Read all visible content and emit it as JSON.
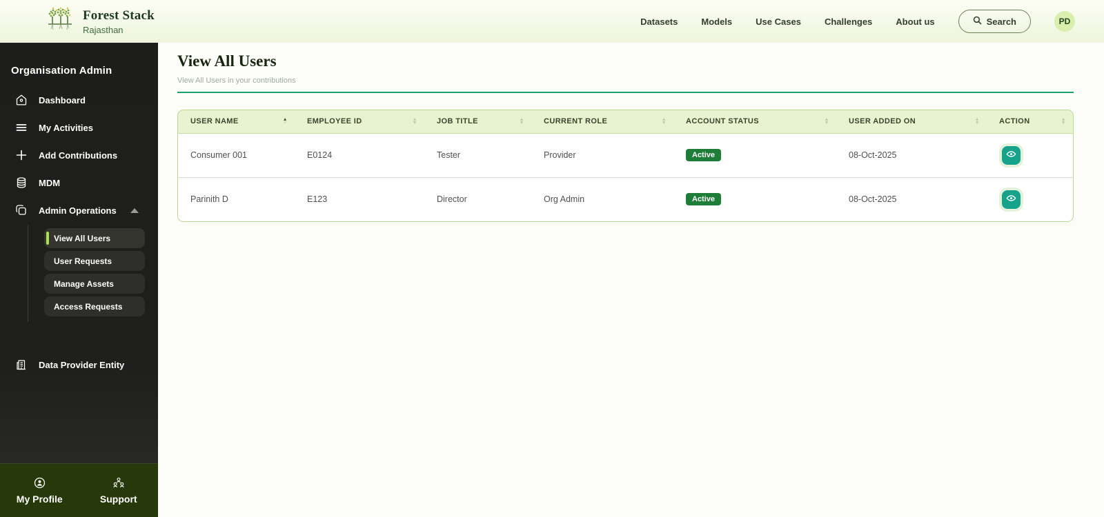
{
  "header": {
    "brand": {
      "title": "Forest Stack",
      "subtitle": "Rajasthan"
    },
    "nav": {
      "datasets": "Datasets",
      "models": "Models",
      "use_cases": "Use Cases",
      "challenges": "Challenges",
      "about_us": "About us"
    },
    "search_label": "Search",
    "avatar_initials": "PD"
  },
  "sidebar": {
    "title": "Organisation Admin",
    "items": {
      "dashboard": "Dashboard",
      "my_activities": "My Activities",
      "add_contributions": "Add Contributions",
      "mdm": "MDM",
      "admin_operations": "Admin Operations"
    },
    "admin_sub_items": {
      "view_all_users": "View All Users",
      "user_requests": "User Requests",
      "manage_assets": "Manage Assets",
      "access_requests": "Access Requests"
    },
    "entity": "Data Provider Entity",
    "bottom": {
      "my_profile": "My Profile",
      "support": "Support"
    }
  },
  "main": {
    "title": "View All Users",
    "subtitle": "View All Users in your contributions",
    "table": {
      "columns": [
        "USER NAME",
        "EMPLOYEE ID",
        "JOB TITLE",
        "CURRENT ROLE",
        "ACCOUNT STATUS",
        "USER ADDED ON",
        "ACTION"
      ],
      "rows": [
        {
          "user_name": "Consumer 001",
          "employee_id": "E0124",
          "job_title": "Tester",
          "current_role": "Provider",
          "account_status": "Active",
          "user_added_on": "08-Oct-2025"
        },
        {
          "user_name": "Parinith D",
          "employee_id": "E123",
          "job_title": "Director",
          "current_role": "Org Admin",
          "account_status": "Active",
          "user_added_on": "08-Oct-2025"
        }
      ]
    }
  },
  "colors": {
    "accent_green": "#1ea06b",
    "sidebar_bg": "#1d1d1b",
    "sidebar_bottom_bg": "#27390a",
    "active_accent": "#a9e24e",
    "table_header_bg": "#e8f3d2",
    "badge_green": "#1e7d37",
    "action_teal": "#17a28c",
    "avatar_bg": "#d9efad"
  }
}
